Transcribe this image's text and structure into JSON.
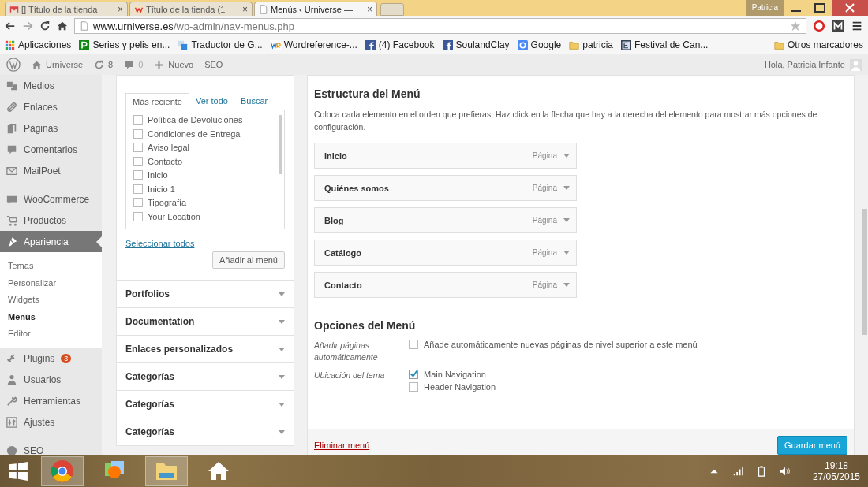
{
  "browser": {
    "tabs": [
      {
        "title": "[] Título de la tienda",
        "kind": "mail",
        "selected": false
      },
      {
        "title": "Título de la tienda (1",
        "kind": "w",
        "selected": false
      },
      {
        "title": "Menús ‹ Urniverse —",
        "kind": "page",
        "selected": true
      }
    ],
    "profile": "Patricia",
    "close_tab": "×",
    "url_host": "www.urniverse.es",
    "url_path": "/wp-admin/nav-menus.php",
    "bookmarks": [
      {
        "label": "Aplicaciones",
        "kind": "apps"
      },
      {
        "label": "Series y pelis en...",
        "kind": "p"
      },
      {
        "label": "Traductor de G...",
        "kind": "translate"
      },
      {
        "label": "Wordreference-...",
        "kind": "wr"
      },
      {
        "label": "(4) Facebook",
        "kind": "fb"
      },
      {
        "label": "SoulandClay",
        "kind": "fb"
      },
      {
        "label": "Google",
        "kind": "google"
      },
      {
        "label": "patricia",
        "kind": "folder"
      },
      {
        "label": "Festival de Can...",
        "kind": "e"
      }
    ],
    "other_bookmarks": "Otros marcadores"
  },
  "admin_bar": {
    "site": "Urniverse",
    "updates": "8",
    "comments": "0",
    "new": "Nuevo",
    "seo": "SEO",
    "greeting": "Hola, Patricia Infante"
  },
  "sidebar": {
    "groups": [
      [
        {
          "label": "Medios",
          "kind": "media",
          "selected": false
        },
        {
          "label": "Enlaces",
          "kind": "link",
          "selected": false
        },
        {
          "label": "Páginas",
          "kind": "pages",
          "selected": false
        },
        {
          "label": "Comentarios",
          "kind": "comment",
          "selected": false
        },
        {
          "label": "MailPoet",
          "kind": "mail",
          "selected": false
        }
      ],
      [
        {
          "label": "WooCommerce",
          "kind": "woo",
          "selected": false
        },
        {
          "label": "Productos",
          "kind": "cart",
          "selected": false
        },
        {
          "label": "Apariencia",
          "kind": "brush",
          "selected": true,
          "children": [
            {
              "label": "Temas",
              "selected": false
            },
            {
              "label": "Personalizar",
              "selected": false
            },
            {
              "label": "Widgets",
              "selected": false
            },
            {
              "label": "Menús",
              "selected": true
            },
            {
              "label": "Editor",
              "selected": false
            }
          ]
        },
        {
          "label": "Plugins",
          "kind": "plug",
          "selected": false,
          "badge": "3"
        },
        {
          "label": "Usuarios",
          "kind": "user",
          "selected": false
        },
        {
          "label": "Herramientas",
          "kind": "wrench",
          "selected": false
        },
        {
          "label": "Ajustes",
          "kind": "settings",
          "selected": false
        }
      ],
      [
        {
          "label": "SEO",
          "kind": "seo",
          "selected": false
        }
      ]
    ]
  },
  "pages_box": {
    "tabs": [
      {
        "label": "Más reciente",
        "selected": true
      },
      {
        "label": "Ver todo",
        "selected": false
      },
      {
        "label": "Buscar",
        "selected": false
      }
    ],
    "pages": [
      {
        "label": "Política de Devoluciones",
        "checked": false
      },
      {
        "label": "Condiciones de Entrega",
        "checked": false
      },
      {
        "label": "Aviso legal",
        "checked": false
      },
      {
        "label": "Contacto",
        "checked": false
      },
      {
        "label": "Inicio",
        "checked": false
      },
      {
        "label": "Inicio 1",
        "checked": false
      },
      {
        "label": "Tipografía",
        "checked": false
      },
      {
        "label": "Your Location",
        "checked": false
      }
    ],
    "select_all": "Seleccionar todos",
    "add_button": "Añadir al menú"
  },
  "sections": [
    "Portfolios",
    "Documentation",
    "Enlaces personalizados",
    "Categorías",
    "Categorías",
    "Categorías"
  ],
  "structure": {
    "title": "Estructura del Menú",
    "description": "Coloca cada elemento en el orden que prefieras. Haz click en la flecha que hay a la derecha del elemento para mostrar más opciones de configuración.",
    "items": [
      {
        "title": "Inicio",
        "type": "Página"
      },
      {
        "title": "Quiénes somos",
        "type": "Página"
      },
      {
        "title": "Blog",
        "type": "Página"
      },
      {
        "title": "Catálogo",
        "type": "Página"
      },
      {
        "title": "Contacto",
        "type": "Página"
      }
    ]
  },
  "options": {
    "title": "Opciones del Menú",
    "rows": [
      {
        "label": "Añadir páginas automáticamente",
        "choices": [
          {
            "label": "Añade automáticamente nuevas páginas de nivel superior a este menú",
            "checked": false
          }
        ]
      },
      {
        "label": "Ubicación del tema",
        "choices": [
          {
            "label": "Main Navigation",
            "checked": true
          },
          {
            "label": "Header Navigation",
            "checked": false
          }
        ]
      }
    ]
  },
  "delete_link": "Eliminar menú",
  "save_button": "Guardar menú",
  "taskbar": {
    "apps": [
      {
        "kind": "chrome",
        "selected": true
      },
      {
        "kind": "photos",
        "selected": false
      },
      {
        "kind": "explorer",
        "selected": true
      },
      {
        "kind": "home",
        "selected": false
      }
    ],
    "time": "19:18",
    "date": "27/05/2015"
  }
}
